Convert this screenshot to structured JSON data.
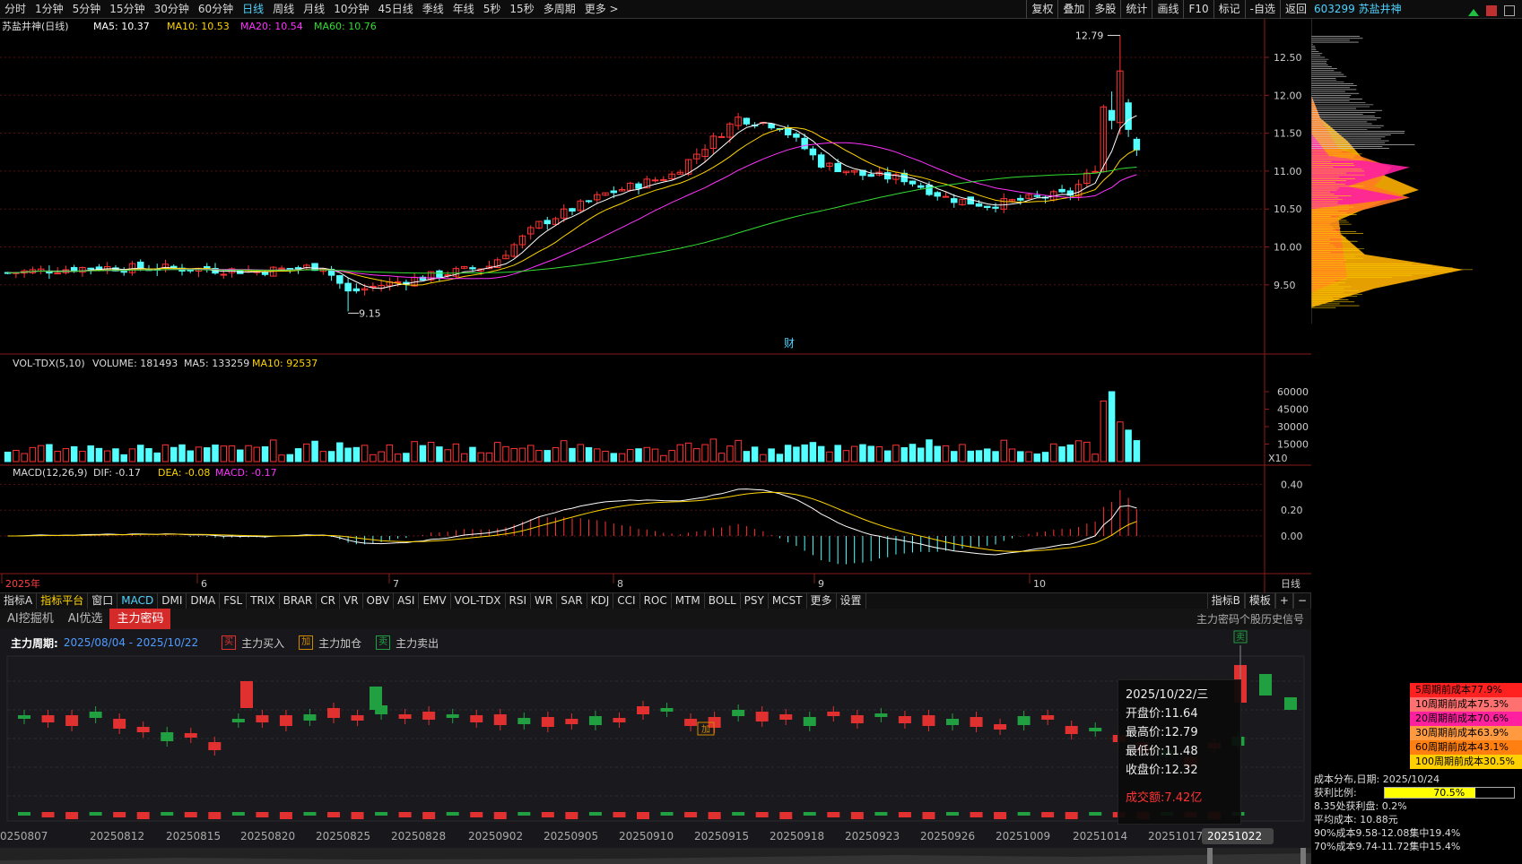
{
  "period_tabs": [
    "分时",
    "1分钟",
    "5分钟",
    "15分钟",
    "30分钟",
    "60分钟",
    "日线",
    "周线",
    "月线",
    "10分钟",
    "45日线",
    "季线",
    "年线",
    "5秒",
    "15秒",
    "多周期",
    "更多 >"
  ],
  "active_period": "日线",
  "right_tools": [
    "复权",
    "叠加",
    "多股",
    "统计",
    "画线",
    "F10",
    "标记",
    "-自选",
    "返回"
  ],
  "stock_header": "603299 苏盐井神",
  "main_chart": {
    "title": "苏盐井神(日线)",
    "indicators": [
      {
        "label": "MA5: 10.37",
        "color": "#ffffff"
      },
      {
        "label": "MA10: 10.53",
        "color": "#ffd400"
      },
      {
        "label": "MA20: 10.54",
        "color": "#ff33ff"
      },
      {
        "label": "MA60: 10.76",
        "color": "#33dd33"
      }
    ],
    "price_ticks": [
      "12.50",
      "12.00",
      "11.50",
      "11.00",
      "10.50",
      "10.00",
      "9.50"
    ],
    "high_marker": "12.79",
    "low_marker": "9.15",
    "event_marker": "财",
    "volume_info": {
      "name": "VOL-TDX(5,10)",
      "volume": "VOLUME: 181493",
      "ma5": "MA5: 133259",
      "ma10": "MA10: 92537"
    },
    "volume_ticks": [
      "60000",
      "45000",
      "30000",
      "15000"
    ],
    "volume_unit": "X10",
    "macd_info": {
      "name": "MACD(12,26,9)",
      "dif": "DIF: -0.17",
      "dea": "DEA: -0.08",
      "macd": "MACD: -0.17"
    },
    "macd_ticks": [
      "0.40",
      "0.20",
      "0.00"
    ],
    "x_labels": [
      "2025年",
      "6",
      "7",
      "8",
      "9",
      "10"
    ],
    "period_label": "日线"
  },
  "indicator_tabs": [
    "指标A",
    "指标平台",
    "窗口",
    "MACD",
    "DMI",
    "DMA",
    "FSL",
    "TRIX",
    "BRAR",
    "CR",
    "VR",
    "OBV",
    "ASI",
    "EMV",
    "VOL-TDX",
    "RSI",
    "WR",
    "SAR",
    "KDJ",
    "CCI",
    "ROC",
    "MTM",
    "BOLL",
    "PSY",
    "MCST",
    "更多",
    "设置"
  ],
  "active_indicator": "MACD",
  "indicator_right": [
    "指标B",
    "模板",
    "+",
    "−"
  ],
  "ai_tabs": [
    "AI挖掘机",
    "AI优选",
    "主力密码"
  ],
  "active_ai_tab": "主力密码",
  "ai_panel": {
    "history_link": "主力密码个股历史信号",
    "period_label": "主力周期:",
    "period_value": "2025/08/04 - 2025/10/22",
    "legend": [
      {
        "box": "买",
        "label": "主力买入",
        "color": "#e03030"
      },
      {
        "box": "加",
        "label": "主力加仓",
        "color": "#d08a00"
      },
      {
        "box": "卖",
        "label": "主力卖出",
        "color": "#20a040"
      }
    ],
    "signal_add": "加",
    "signal_sell": "卖",
    "dates": [
      "0250807",
      "20250812",
      "20250815",
      "20250820",
      "20250825",
      "20250828",
      "20250902",
      "20250905",
      "20250910",
      "20250915",
      "20250918",
      "20250923",
      "20250926",
      "20251009",
      "20251014",
      "20251017",
      "20251022"
    ],
    "active_date": "20251022",
    "tooltip": {
      "date": "2025/10/22/三",
      "open": "开盘价:11.64",
      "high": "最高价:12.79",
      "low": "最低价:11.48",
      "close": "收盘价:12.32",
      "amount": "成交额:7.42亿"
    }
  },
  "chip": {
    "price_ticks": [
      "12.50",
      "12.00",
      "11.50",
      "11.00",
      "10.50",
      "10.00",
      "9.50"
    ],
    "cost_rows": [
      {
        "label": "5周期前成本77.9%",
        "color": "#ff2020"
      },
      {
        "label": "10周期前成本75.3%",
        "color": "#ff7070"
      },
      {
        "label": "20周期前成本70.6%",
        "color": "#ff20a0"
      },
      {
        "label": "30周期前成本63.9%",
        "color": "#ff9a40"
      },
      {
        "label": "60周期前成本43.1%",
        "color": "#ff8010"
      },
      {
        "label": "100周期前成本30.5%",
        "color": "#ffd000"
      }
    ],
    "dist_date": "成本分布,日期: 2025/10/24",
    "profit_label": "获利比例:",
    "profit_value": "70.5%",
    "profit_ratio": 0.705,
    "profit_at": "8.35处获利盘: 0.2%",
    "avg_cost": "平均成本: 10.88元",
    "cost90": "90%成本9.58-12.08集中19.4%",
    "cost70": "70%成本9.74-11.72集中15.4%"
  }
}
